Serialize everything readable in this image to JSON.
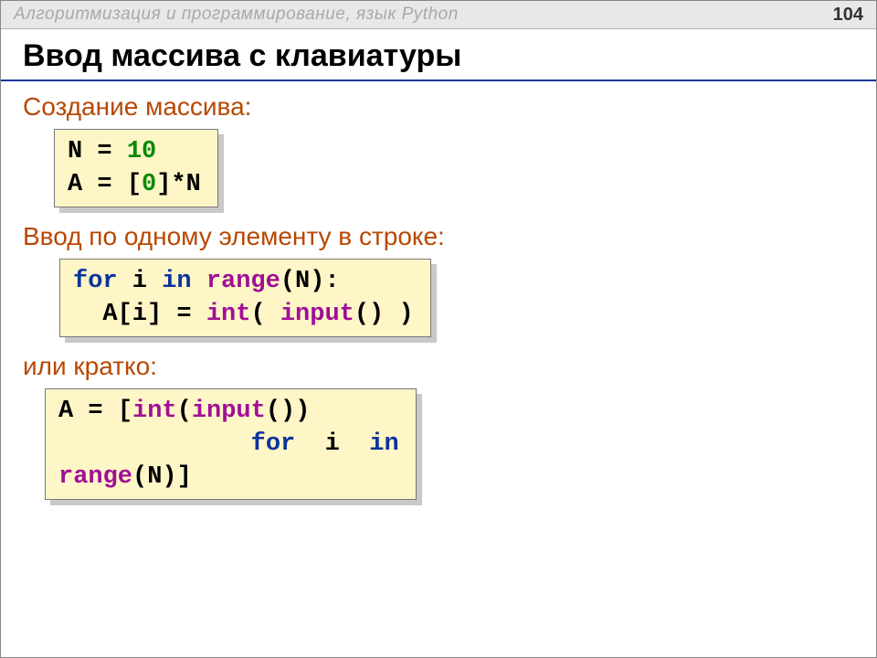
{
  "header": {
    "caption": "Алгоритмизация и программирование, язык Python",
    "page": "104"
  },
  "title": "Ввод массива с клавиатуры",
  "sections": {
    "s1_label": "Создание массива:",
    "s2_label": "Ввод по одному элементу в строке:",
    "s3_label": "или кратко:"
  },
  "code1": {
    "t1": "N ",
    "eq1": "=",
    "sp1": " ",
    "n10": "10",
    "nl1": "\n",
    "t2": "A ",
    "eq2": "=",
    "sp2": " ",
    "lb1": "[",
    "n0": "0",
    "rb1": "]*N"
  },
  "code2": {
    "for": "for",
    "sp1": " i ",
    "in": "in",
    "sp2": " ",
    "range": "range",
    "par": "(N):",
    "nl": "\n",
    "ind": "  A[i] ",
    "eq": "=",
    "sp3": " ",
    "intfn": "int",
    "lp": "( ",
    "inputfn": "input",
    "rp": "() )"
  },
  "code3": {
    "t1": "A ",
    "eq": "=",
    "sp1": " ",
    "lb": "[",
    "intfn": "int",
    "lp": "(",
    "inputfn": "input",
    "rp": "())",
    "nl1": "\n",
    "ind1": "             ",
    "for": "for",
    "sp2": "  i  ",
    "in": "in",
    "nl2": "\n",
    "range": "range",
    "par": "(N)]"
  }
}
